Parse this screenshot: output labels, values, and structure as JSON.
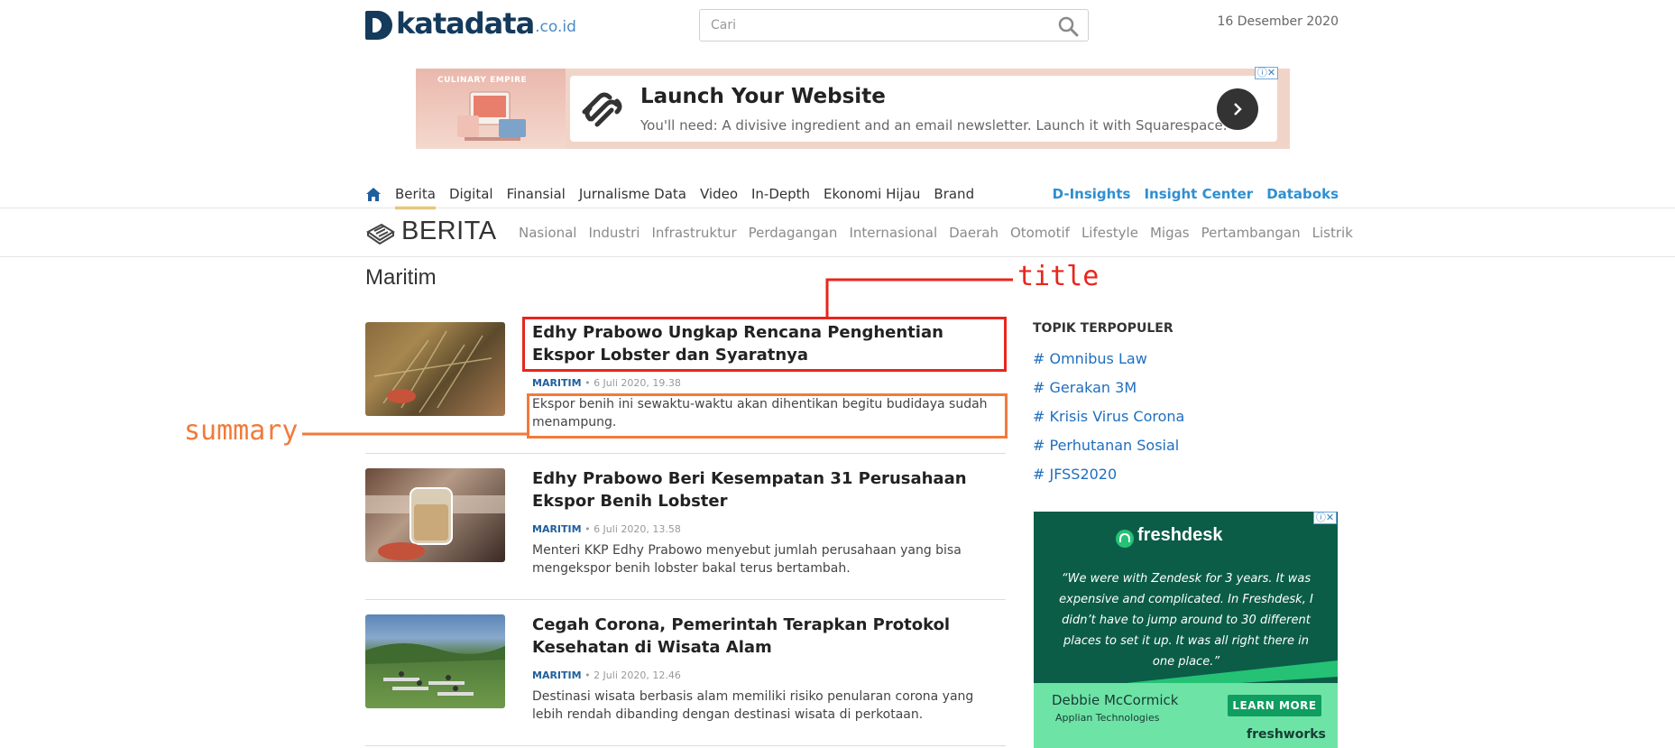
{
  "header": {
    "logo_text": "katadata",
    "logo_tld": ".co.id",
    "search_placeholder": "Cari",
    "date": "16 Desember 2020"
  },
  "top_ad": {
    "thumb_text": "CULINARY EMPIRE",
    "title": "Launch Your Website",
    "description": "You'll need: A divisive ingredient and an email newsletter. Launch it with Squarespace."
  },
  "nav": {
    "items": [
      "Berita",
      "Digital",
      "Finansial",
      "Jurnalisme Data",
      "Video",
      "In-Depth",
      "Ekonomi Hijau",
      "Brand"
    ],
    "right_items": [
      "D-Insights",
      "Insight Center",
      "Databoks"
    ]
  },
  "section": {
    "title": "BERITA",
    "subnav": [
      "Nasional",
      "Industri",
      "Infrastruktur",
      "Perdagangan",
      "Internasional",
      "Daerah",
      "Otomotif",
      "Lifestyle",
      "Migas",
      "Pertambangan",
      "Listrik"
    ]
  },
  "page_heading": "Maritim",
  "articles": [
    {
      "title": "Edhy Prabowo Ungkap Rencana Penghentian Ekspor Lobster dan Syaratnya",
      "category": "MARITIM",
      "time": "• 6 Juli 2020, 19.38",
      "summary": "Ekspor benih ini sewaktu-waktu akan dihentikan begitu budidaya sudah menampung."
    },
    {
      "title": "Edhy Prabowo Beri Kesempatan 31 Perusahaan Ekspor Benih Lobster",
      "category": "MARITIM",
      "time": "• 6 Juli 2020, 13.58",
      "summary": "Menteri KKP Edhy Prabowo menyebut jumlah perusahaan yang bisa mengekspor benih lobster bakal terus bertambah."
    },
    {
      "title": "Cegah Corona, Pemerintah Terapkan Protokol Kesehatan di Wisata Alam",
      "category": "MARITIM",
      "time": "• 2 Juli 2020, 12.46",
      "summary": "Destinasi wisata berbasis alam memiliki risiko penularan corona yang lebih rendah dibanding dengan destinasi wisata di perkotaan."
    }
  ],
  "sidebar": {
    "title": "TOPIK TERPOPULER",
    "topics": [
      "# Omnibus Law",
      "# Gerakan 3M",
      "# Krisis Virus Corona",
      "# Perhutanan Sosial",
      "# JFSS2020"
    ]
  },
  "side_ad": {
    "brand": "freshdesk",
    "quote": "“We were with Zendesk for 3 years. It was expensive and complicated. In Freshdesk, I didn’t have to jump around to 30 different places to set it up. It was all right there in one place.”",
    "person": "Debbie McCormick",
    "company": "Applian Technologies",
    "cta": "LEARN MORE",
    "footer_brand": "freshworks"
  },
  "annotations": {
    "title_label": "title",
    "summary_label": "summary",
    "title_color": "#e8261c",
    "summary_color": "#f27a3a"
  },
  "colors": {
    "brand_navy": "#143a5c",
    "link_blue": "#2f8fd1",
    "category_blue": "#1f5f9e",
    "active_underline": "#e2b030"
  }
}
